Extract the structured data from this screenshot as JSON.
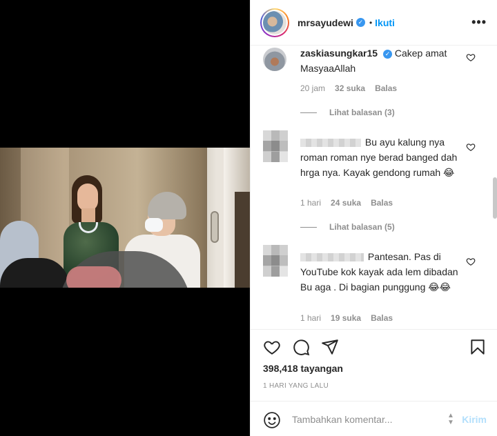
{
  "post": {
    "username": "mrsayudewi",
    "follow_label": "Ikuti",
    "dot": "•",
    "more_label": "•••",
    "views": "398,418 tayangan",
    "time_ago": "1 HARI YANG LALU"
  },
  "comments": [
    {
      "username": "zaskiasungkar15",
      "verified": true,
      "text": "Cakep amat MasyaaAllah",
      "time": "20 jam",
      "likes": "32 suka",
      "reply_label": "Balas",
      "view_replies": "Lihat balasan (3)"
    },
    {
      "username": "",
      "text": "Bu ayu kalung nya roman roman nye berad banged dah hrga nya. Kayak gendong rumah 😂",
      "time": "1 hari",
      "likes": "24 suka",
      "reply_label": "Balas",
      "view_replies": "Lihat balasan (5)"
    },
    {
      "username": "",
      "text": "Pantesan. Pas di YouTube kok kayak ada lem dibadan Bu aga . Di bagian punggung 😂😂",
      "time": "1 hari",
      "likes": "19 suka",
      "reply_label": "Balas"
    }
  ],
  "add_comment": {
    "placeholder": "Tambahkan komentar...",
    "send_label": "Kirim"
  },
  "colors": {
    "accent": "#0095f6",
    "verified": "#3897f0",
    "secondary_text": "#8e8e8e",
    "send_disabled": "#b2dffc"
  },
  "icons": [
    "heart-icon",
    "comment-icon",
    "share-icon",
    "bookmark-icon",
    "emoji-icon",
    "verified-icon",
    "more-icon"
  ]
}
